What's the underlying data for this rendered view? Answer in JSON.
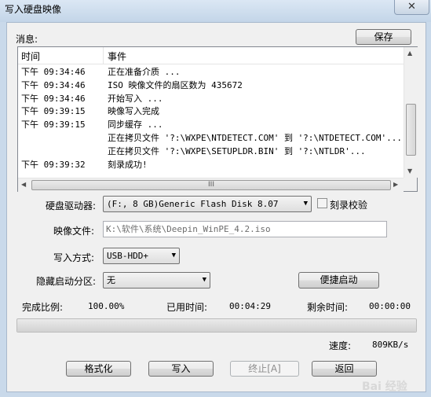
{
  "window": {
    "title": "写入硬盘映像",
    "close_glyph": "✕"
  },
  "messages": {
    "label": "消息:",
    "save_label": "保存",
    "columns": {
      "time": "时间",
      "event": "事件"
    },
    "rows": [
      {
        "time": "下午 09:34:46",
        "event": "正在准备介质 ..."
      },
      {
        "time": "下午 09:34:46",
        "event": "ISO 映像文件的扇区数为 435672"
      },
      {
        "time": "下午 09:34:46",
        "event": "开始写入 ..."
      },
      {
        "time": "下午 09:39:15",
        "event": "映像写入完成"
      },
      {
        "time": "下午 09:39:15",
        "event": "同步缓存 ..."
      },
      {
        "time": "",
        "event": "正在拷贝文件 '?:\\WXPE\\NTDETECT.COM' 到 '?:\\NTDETECT.COM'..."
      },
      {
        "time": "",
        "event": "正在拷贝文件 '?:\\WXPE\\SETUPLDR.BIN' 到 '?:\\NTLDR'..."
      },
      {
        "time": "下午 09:39:32",
        "event": "刻录成功!"
      }
    ],
    "hscroll_grip": "III"
  },
  "drive": {
    "label": "硬盘驱动器:",
    "value": "(F:, 8 GB)Generic Flash Disk       8.07",
    "verify_label": "刻录校验",
    "verify_checked": false
  },
  "image_file": {
    "label": "映像文件:",
    "value": "K:\\软件\\系统\\Deepin_WinPE_4.2.iso"
  },
  "write_method": {
    "label": "写入方式:",
    "value": "USB-HDD+"
  },
  "hidden_partition": {
    "label": "隐藏启动分区:",
    "value": "无",
    "quick_boot_label": "便捷启动"
  },
  "status": {
    "complete_label": "完成比例:",
    "complete_value": "100.00%",
    "elapsed_label": "已用时间:",
    "elapsed_value": "00:04:29",
    "remaining_label": "剩余时间:",
    "remaining_value": "00:00:00",
    "progress_fraction": 1.0,
    "speed_label": "速度:",
    "speed_value": "809KB/s"
  },
  "actions": {
    "format": "格式化",
    "write": "写入",
    "abort": "终止[A]",
    "back": "返回"
  },
  "watermark": "Bai 经验"
}
